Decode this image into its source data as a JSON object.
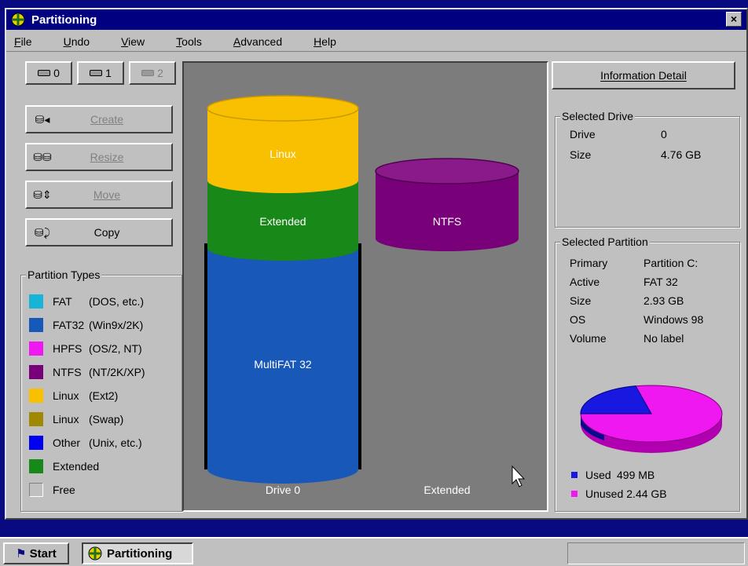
{
  "window": {
    "title": "Partitioning",
    "close_glyph": "×"
  },
  "menu": [
    "File",
    "Undo",
    "View",
    "Tools",
    "Advanced",
    "Help"
  ],
  "drive_buttons": [
    {
      "label": "0",
      "enabled": true
    },
    {
      "label": "1",
      "enabled": true
    },
    {
      "label": "2",
      "enabled": false
    }
  ],
  "operations": [
    {
      "label": "Create",
      "icon": "create-partition-icon",
      "enabled": false
    },
    {
      "label": "Resize",
      "icon": "resize-partition-icon",
      "enabled": false
    },
    {
      "label": "Move",
      "icon": "move-partition-icon",
      "enabled": false
    },
    {
      "label": "Copy",
      "icon": "copy-partition-icon",
      "enabled": true
    }
  ],
  "partition_types": {
    "title": "Partition Types",
    "items": [
      {
        "name": "FAT",
        "desc": "(DOS, etc.)",
        "color": "#18b4d8"
      },
      {
        "name": "FAT32",
        "desc": "(Win9x/2K)",
        "color": "#1858b8"
      },
      {
        "name": "HPFS",
        "desc": "(OS/2, NT)",
        "color": "#f018f0"
      },
      {
        "name": "NTFS",
        "desc": "(NT/2K/XP)",
        "color": "#780078"
      },
      {
        "name": "Linux",
        "desc": "(Ext2)",
        "color": "#f8c000"
      },
      {
        "name": "Linux",
        "desc": "(Swap)",
        "color": "#a08800"
      },
      {
        "name": "Other",
        "desc": "(Unix, etc.)",
        "color": "#0000f0"
      },
      {
        "name": "Extended",
        "desc": "",
        "color": "#188818"
      },
      {
        "name": "Free",
        "desc": "",
        "color": "#c0c0c0"
      }
    ]
  },
  "canvas": {
    "drive_stack": [
      "Linux",
      "Extended",
      "MultiFAT 32"
    ],
    "drive_stack_colors": [
      "#f8c000",
      "#188818",
      "#1858b8"
    ],
    "extended_stack": [
      "NTFS"
    ],
    "extended_stack_colors": [
      "#780078"
    ],
    "drive_caption": "Drive 0",
    "extended_caption": "Extended"
  },
  "info_button": "Information Detail",
  "selected_drive": {
    "title": "Selected Drive",
    "rows": [
      {
        "k": "Drive",
        "v": "0"
      },
      {
        "k": "Size",
        "v": "4.76 GB"
      }
    ]
  },
  "selected_partition": {
    "title": "Selected Partition",
    "rows": [
      {
        "k": "Primary",
        "v": "Partition C:"
      },
      {
        "k": "Active",
        "v": "FAT 32"
      },
      {
        "k": "Size",
        "v": "2.93 GB"
      },
      {
        "k": "OS",
        "v": "Windows 98"
      },
      {
        "k": "Volume",
        "v": "No label"
      }
    ],
    "usage": {
      "used_label": "Used",
      "used_value": "499 MB",
      "used_color": "#1818e0",
      "unused_label": "Unused",
      "unused_value": "2.44 GB",
      "unused_color": "#f018f0",
      "used_fraction": 0.17
    }
  },
  "taskbar": {
    "start": "Start",
    "task": "Partitioning"
  }
}
